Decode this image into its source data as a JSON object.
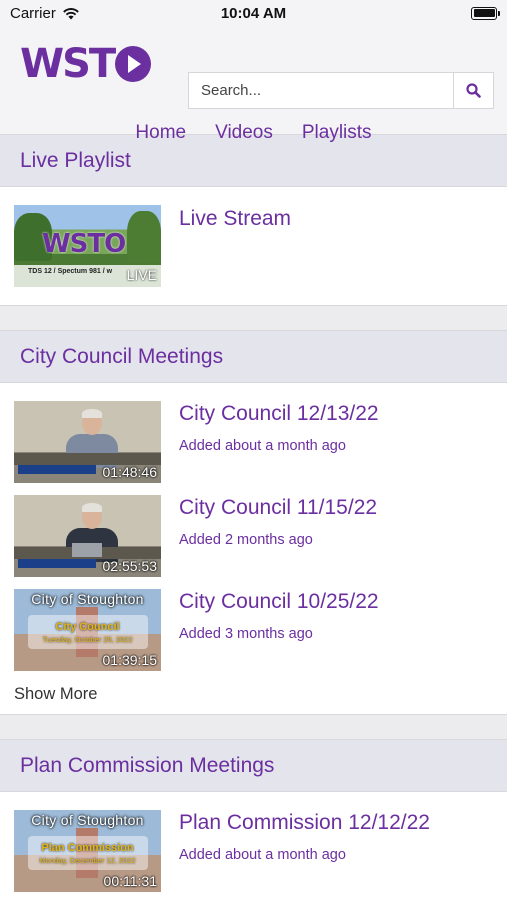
{
  "status_bar": {
    "carrier": "Carrier",
    "time": "10:04 AM"
  },
  "header": {
    "logo": "WST",
    "search_placeholder": "Search..."
  },
  "nav": {
    "home": "Home",
    "videos": "Videos",
    "playlists": "Playlists"
  },
  "live_playlist": {
    "heading": "Live Playlist",
    "items": [
      {
        "title": "Live Stream",
        "badge": "LIVE",
        "thumb_caption": "TDS 12 / Spectum 981 / w"
      }
    ]
  },
  "city_council": {
    "heading": "City Council Meetings",
    "items": [
      {
        "title": "City Council 12/13/22",
        "added": "Added about a month ago",
        "duration": "01:48:46"
      },
      {
        "title": "City Council 11/15/22",
        "added": "Added 2 months ago",
        "duration": "02:55:53"
      },
      {
        "title": "City Council 10/25/22",
        "added": "Added 3 months ago",
        "duration": "01:39:15",
        "thumb_city": "City of Stoughton",
        "thumb_meeting": "City Council",
        "thumb_date": "Tuesday, October 25, 2022"
      }
    ],
    "show_more": "Show More"
  },
  "plan_commission": {
    "heading": "Plan Commission Meetings",
    "items": [
      {
        "title": "Plan Commission 12/12/22",
        "added": "Added about a month ago",
        "duration": "00:11:31",
        "thumb_city": "City of Stoughton",
        "thumb_meeting": "Plan Commission",
        "thumb_date": "Monday, December 12, 2022"
      }
    ]
  },
  "colors": {
    "brand": "#6b2fa0",
    "section_header_bg": "#e4e4ec"
  }
}
